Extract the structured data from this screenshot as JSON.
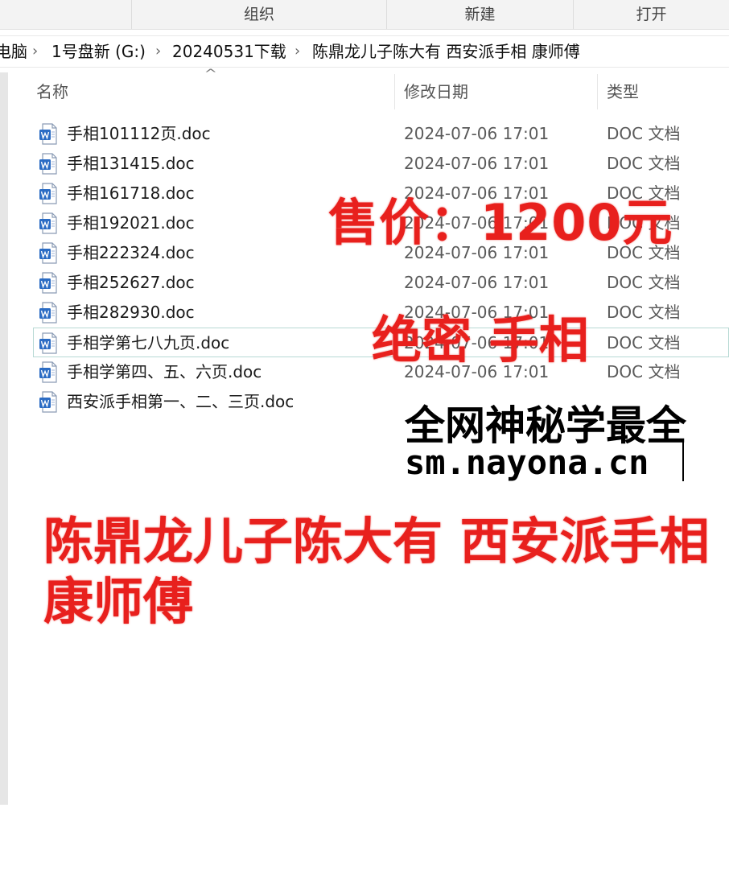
{
  "ribbon": {
    "organize_label": "组织",
    "new_label": "新建",
    "open_label": "打开"
  },
  "breadcrumb": {
    "items": [
      "电脑",
      "1号盘新 (G:)",
      "20240531下载",
      "陈鼎龙儿子陈大有 西安派手相  康师傅"
    ]
  },
  "columns": {
    "name": "名称",
    "modified": "修改日期",
    "type": "类型"
  },
  "files": [
    {
      "name": "手相101112页.doc",
      "modified": "2024-07-06 17:01",
      "type": "DOC 文档"
    },
    {
      "name": "手相131415.doc",
      "modified": "2024-07-06 17:01",
      "type": "DOC 文档"
    },
    {
      "name": "手相161718.doc",
      "modified": "2024-07-06 17:01",
      "type": "DOC 文档"
    },
    {
      "name": "手相192021.doc",
      "modified": "2024-07-06 17:01",
      "type": "DOC 文档"
    },
    {
      "name": "手相222324.doc",
      "modified": "2024-07-06 17:01",
      "type": "DOC 文档"
    },
    {
      "name": "手相252627.doc",
      "modified": "2024-07-06 17:01",
      "type": "DOC 文档"
    },
    {
      "name": "手相282930.doc",
      "modified": "2024-07-06 17:01",
      "type": "DOC 文档"
    },
    {
      "name": "手相学第七八九页.doc",
      "modified": "2024-07-06 17:01",
      "type": "DOC 文档"
    },
    {
      "name": "手相学第四、五、六页.doc",
      "modified": "2024-07-06 17:01",
      "type": "DOC 文档"
    },
    {
      "name": "西安派手相第一、二、三页.doc",
      "modified": "",
      "type": ""
    }
  ],
  "overlay": {
    "price": "售价：1200元",
    "secret": "绝密 手相",
    "promo_line1": "全网神秘学最全",
    "promo_line2": "sm.nayona.cn",
    "title_line1": "陈鼎龙儿子陈大有 西安派手相",
    "title_line2": "康师傅"
  },
  "colors": {
    "overlay_red": "#e8201d",
    "word_icon_blue": "#2b6cc4",
    "selection_border": "#b7d9d4"
  }
}
